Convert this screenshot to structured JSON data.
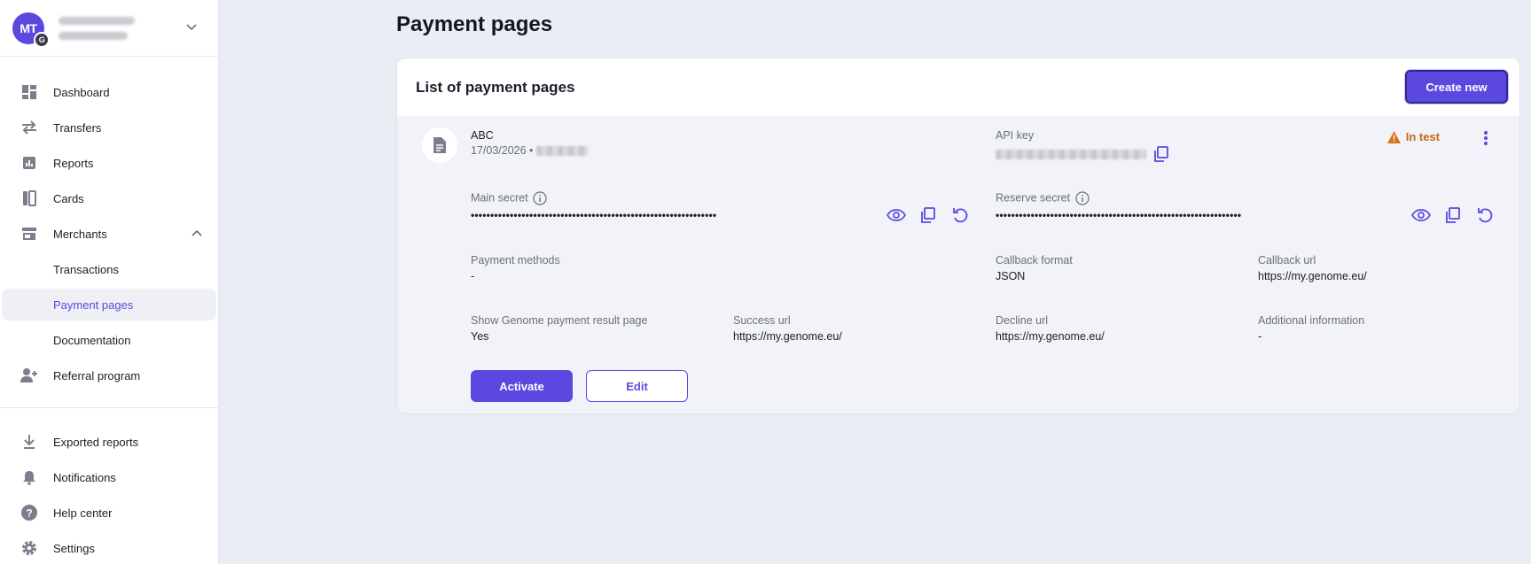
{
  "account": {
    "avatar_initials": "MT",
    "badge": "G"
  },
  "sidebar": {
    "items": [
      {
        "label": "Dashboard",
        "icon": "dashboard-icon"
      },
      {
        "label": "Transfers",
        "icon": "transfers-icon"
      },
      {
        "label": "Reports",
        "icon": "reports-icon"
      },
      {
        "label": "Cards",
        "icon": "cards-icon"
      },
      {
        "label": "Merchants",
        "icon": "store-icon"
      },
      {
        "label": "Transactions"
      },
      {
        "label": "Payment pages"
      },
      {
        "label": "Documentation"
      },
      {
        "label": "Referral program",
        "icon": "add-user-icon"
      }
    ],
    "bottom": [
      {
        "label": "Exported reports",
        "icon": "download-icon"
      },
      {
        "label": "Notifications",
        "icon": "bell-icon"
      },
      {
        "label": "Help center",
        "icon": "help-icon"
      },
      {
        "label": "Settings",
        "icon": "gear-icon"
      }
    ]
  },
  "main": {
    "title": "Payment pages",
    "card_title": "List of payment pages",
    "create_label": "Create new"
  },
  "page": {
    "name": "ABC",
    "date": "17/03/2026 •",
    "api_key_label": "API key",
    "status": "In test",
    "main_secret_label": "Main secret",
    "main_secret_value": "•••••••••••••••••••••••••••••••••••••••••••••••••••••••••••••••",
    "reserve_secret_label": "Reserve secret",
    "reserve_secret_value": "•••••••••••••••••••••••••••••••••••••••••••••••••••••••••••••••",
    "payment_methods_label": "Payment methods",
    "payment_methods_value": "-",
    "callback_format_label": "Callback format",
    "callback_format_value": "JSON",
    "callback_url_label": "Callback url",
    "callback_url_value": "https://my.genome.eu/",
    "show_result_label": "Show Genome payment result page",
    "show_result_value": "Yes",
    "success_url_label": "Success url",
    "success_url_value": "https://my.genome.eu/",
    "decline_url_label": "Decline url",
    "decline_url_value": "https://my.genome.eu/",
    "additional_info_label": "Additional information",
    "additional_info_value": "-",
    "activate_label": "Activate",
    "edit_label": "Edit"
  },
  "colors": {
    "accent": "#5b48e0",
    "warning": "#c26a14",
    "background": "#e9edf4"
  }
}
